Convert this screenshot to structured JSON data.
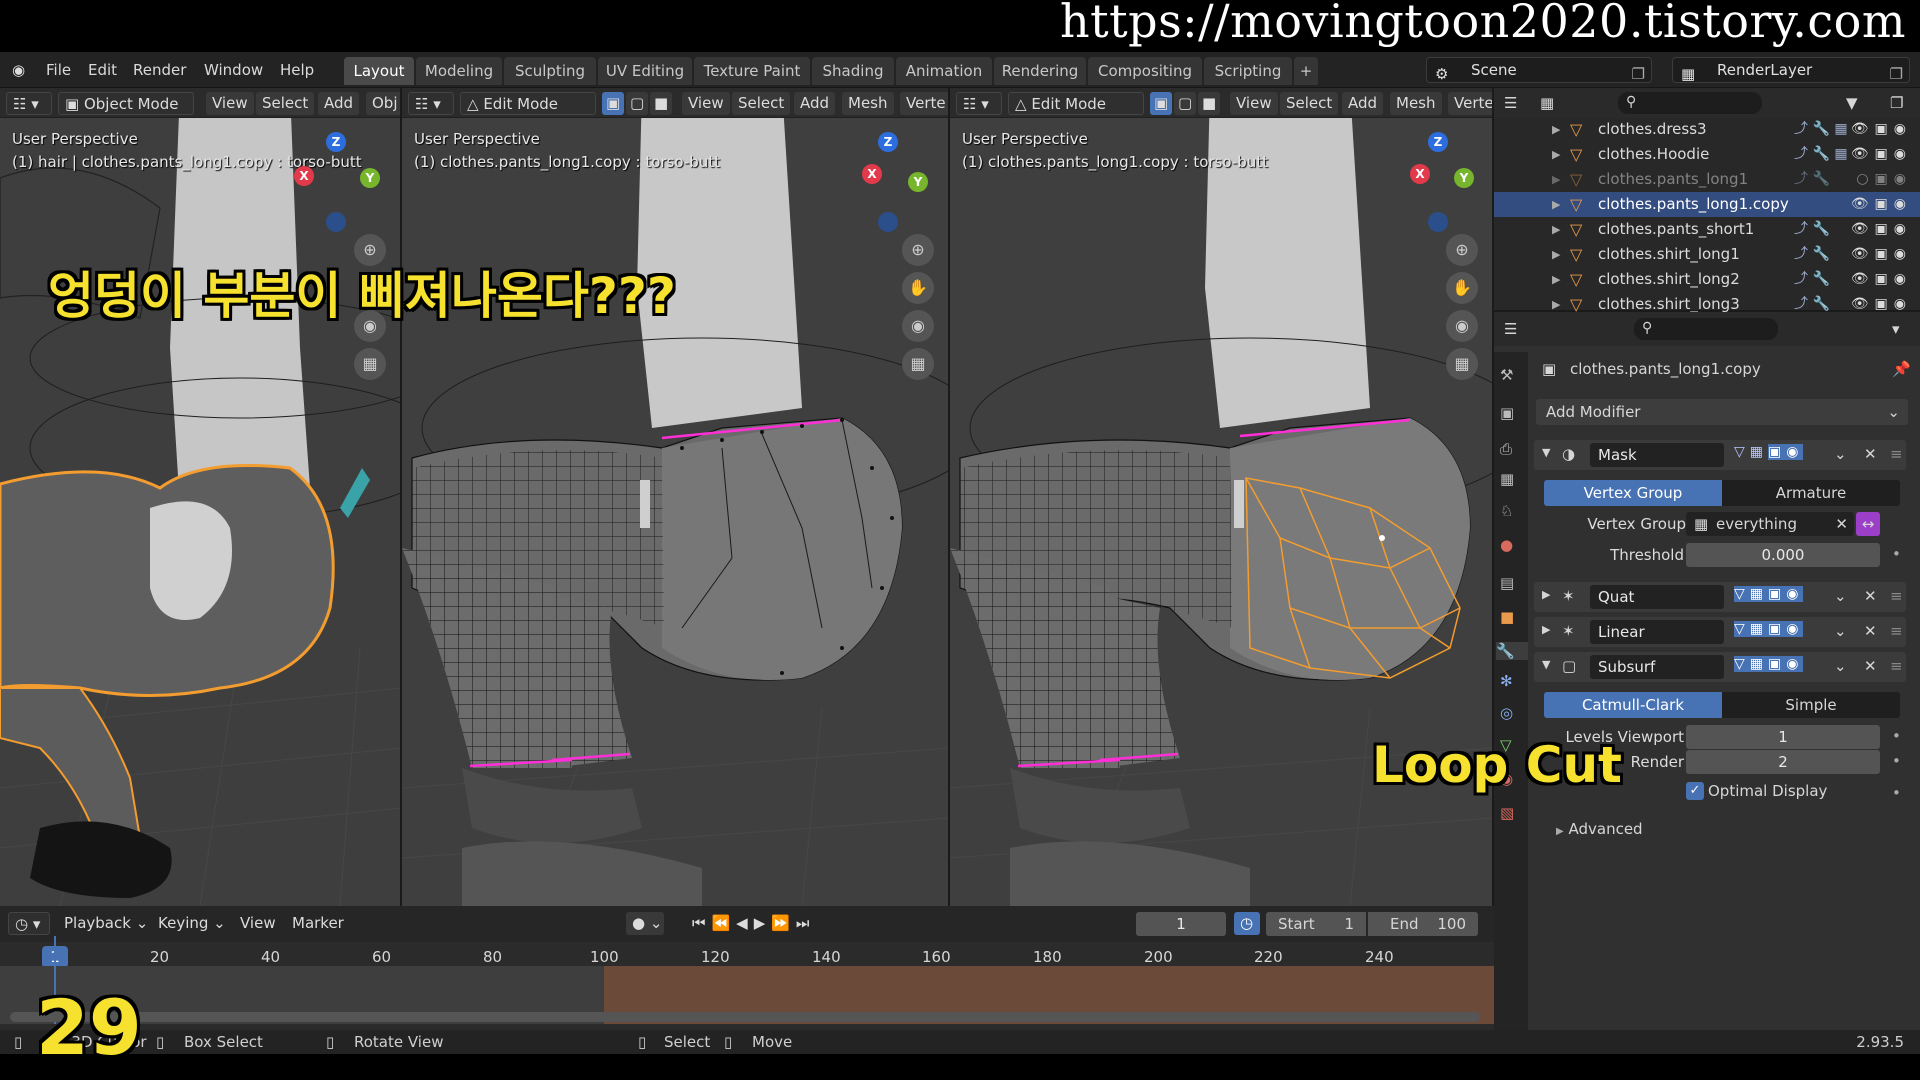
{
  "watermark": "https://movingtoon2020.tistory.com",
  "menu": {
    "items": [
      "File",
      "Edit",
      "Render",
      "Window",
      "Help"
    ]
  },
  "workspaces": [
    "Layout",
    "Modeling",
    "Sculpting",
    "UV Editing",
    "Texture Paint",
    "Shading",
    "Animation",
    "Rendering",
    "Compositing",
    "Scripting"
  ],
  "workspace_add": "+",
  "scene_label": "Scene",
  "render_layer_label": "RenderLayer",
  "viewports": [
    {
      "mode": "Object Mode",
      "menus": [
        "View",
        "Select",
        "Add",
        "Obj"
      ],
      "title": "User Perspective",
      "subtitle": "(1) hair | clothes.pants_long1.copy : torso-butt"
    },
    {
      "mode": "Edit Mode",
      "menus": [
        "View",
        "Select",
        "Add",
        "Mesh",
        "Verte"
      ],
      "title": "User Perspective",
      "subtitle": "(1) clothes.pants_long1.copy : torso-butt"
    },
    {
      "mode": "Edit Mode",
      "menus": [
        "View",
        "Select",
        "Add",
        "Mesh",
        "Verte"
      ],
      "title": "User Perspective",
      "subtitle": "(1) clothes.pants_long1.copy : torso-butt"
    }
  ],
  "gizmo": {
    "x": "X",
    "y": "Y",
    "z": "Z"
  },
  "captions": {
    "left": "엉덩이 부분이 삐져나온다???",
    "right": "Loop Cut",
    "episode": "29"
  },
  "outliner": {
    "items": [
      {
        "name": "clothes.dress3",
        "dim": false,
        "selected": false
      },
      {
        "name": "clothes.Hoodie",
        "dim": false,
        "selected": false
      },
      {
        "name": "clothes.pants_long1",
        "dim": true,
        "selected": false
      },
      {
        "name": "clothes.pants_long1.copy",
        "dim": false,
        "selected": true
      },
      {
        "name": "clothes.pants_short1",
        "dim": false,
        "selected": false
      },
      {
        "name": "clothes.shirt_long1",
        "dim": false,
        "selected": false
      },
      {
        "name": "clothes.shirt_long2",
        "dim": false,
        "selected": false
      },
      {
        "name": "clothes.shirt_long3",
        "dim": false,
        "selected": false
      }
    ]
  },
  "properties": {
    "object_name": "clothes.pants_long1.copy",
    "add_modifier": "Add Modifier",
    "modifiers": {
      "mask": {
        "name": "Mask",
        "tab_active": "Vertex Group",
        "tab_other": "Armature",
        "vg_label": "Vertex Group",
        "vg_value": "everything",
        "threshold_label": "Threshold",
        "threshold_value": "0.000"
      },
      "quat": {
        "name": "Quat"
      },
      "linear": {
        "name": "Linear"
      },
      "subsurf": {
        "name": "Subsurf",
        "tab_active": "Catmull-Clark",
        "tab_other": "Simple",
        "levels_label": "Levels Viewport",
        "levels_value": "1",
        "render_label": "Render",
        "render_value": "2",
        "optimal_label": "Optimal Display",
        "optimal_checked": true,
        "advanced_label": "Advanced"
      }
    }
  },
  "timeline": {
    "menus": [
      "Playback",
      "Keying",
      "View",
      "Marker"
    ],
    "current_frame": "1",
    "start_label": "Start",
    "start_value": "1",
    "end_label": "End",
    "end_value": "100",
    "ruler": [
      "1",
      "20",
      "40",
      "60",
      "80",
      "100",
      "120",
      "140",
      "160",
      "180",
      "200",
      "220",
      "240"
    ]
  },
  "statusbar": {
    "items": [
      "Set 3D Cursor",
      "Box Select",
      "Rotate View",
      "Select",
      "Move"
    ],
    "version": "2.93.5"
  },
  "colors": {
    "accent": "#4772b3",
    "selection_orange": "#f39c2f",
    "caption_yellow": "#f5e12e",
    "edge_magenta": "#ff2fd7"
  }
}
